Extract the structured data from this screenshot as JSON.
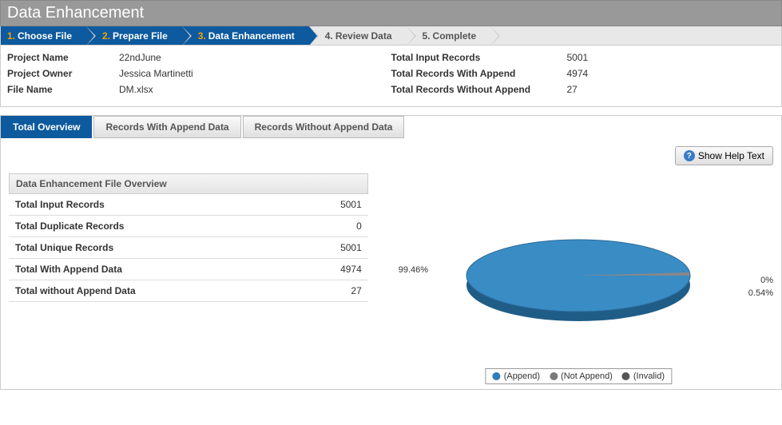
{
  "page_title": "Data Enhancement",
  "breadcrumb": [
    {
      "num": "1.",
      "label": "Choose File",
      "active": true
    },
    {
      "num": "2.",
      "label": "Prepare File",
      "active": true
    },
    {
      "num": "3.",
      "label": "Data Enhancement",
      "active": true
    },
    {
      "num": "4.",
      "label": "Review Data",
      "active": false
    },
    {
      "num": "5.",
      "label": "Complete",
      "active": false
    }
  ],
  "info_left": [
    {
      "label": "Project Name",
      "value": "22ndJune"
    },
    {
      "label": "Project Owner",
      "value": "Jessica Martinetti"
    },
    {
      "label": "File Name",
      "value": "DM.xlsx"
    }
  ],
  "info_right": [
    {
      "label": "Total Input Records",
      "value": "5001"
    },
    {
      "label": "Total Records With Append",
      "value": "4974"
    },
    {
      "label": "Total Records Without Append",
      "value": "27"
    }
  ],
  "tabs": [
    {
      "label": "Total Overview",
      "active": true
    },
    {
      "label": "Records With Append Data",
      "active": false
    },
    {
      "label": "Records Without Append Data",
      "active": false
    }
  ],
  "help_button": "Show Help Text",
  "overview_title": "Data Enhancement File Overview",
  "overview_rows": [
    {
      "label": "Total Input Records",
      "value": "5001"
    },
    {
      "label": "Total Duplicate Records",
      "value": "0"
    },
    {
      "label": "Total Unique Records",
      "value": "5001"
    },
    {
      "label": "Total With Append Data",
      "value": "4974"
    },
    {
      "label": "Total without Append Data",
      "value": "27"
    }
  ],
  "chart_data": {
    "type": "pie",
    "title": "",
    "series": [
      {
        "name": "Append",
        "value": 99.46,
        "color": "#2e7cb8"
      },
      {
        "name": "Not Append",
        "value": 0.54,
        "color": "#7a7a7a"
      },
      {
        "name": "Invalid",
        "value": 0,
        "color": "#555"
      }
    ],
    "labels": [
      "99.46%",
      "0.54%",
      "0%"
    ],
    "legend": [
      "(Append)",
      "(Not Append)",
      "(Invalid)"
    ]
  }
}
